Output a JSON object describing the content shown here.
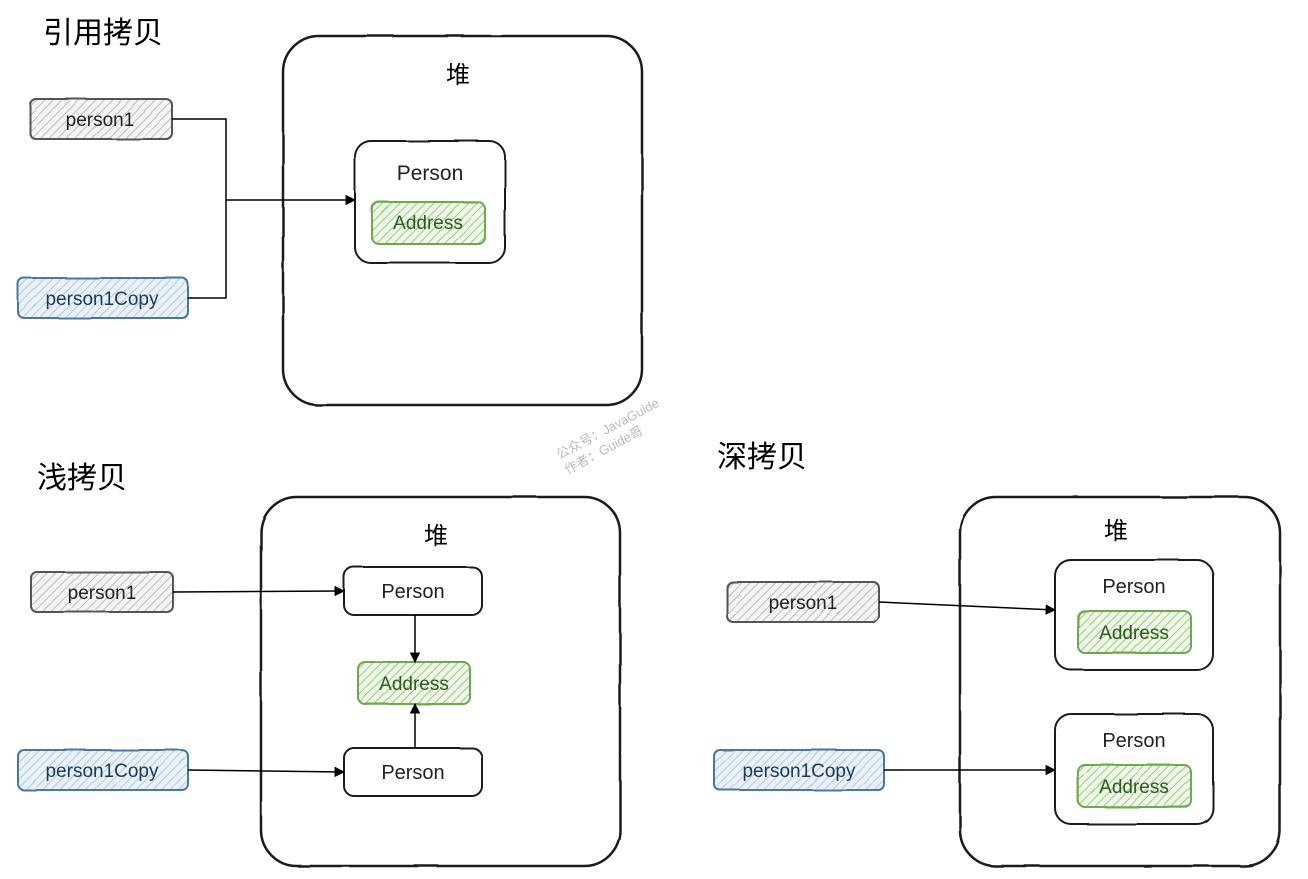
{
  "titles": {
    "refCopy": "引用拷贝",
    "shallowCopy": "浅拷贝",
    "deepCopy": "深拷贝"
  },
  "heapLabel": "堆",
  "labels": {
    "person1": "person1",
    "person1Copy": "person1Copy",
    "Person": "Person",
    "Address": "Address"
  },
  "watermark": {
    "line1": "公众号：JavaGuide",
    "line2": "作者：Guide哥"
  },
  "colors": {
    "grayFill": "#e8e8e8",
    "blueFill": "#d6e4f0",
    "greenFill": "#c8e0bc",
    "greenStroke": "#6fa84f",
    "textGreen": "#3b6e2d"
  }
}
